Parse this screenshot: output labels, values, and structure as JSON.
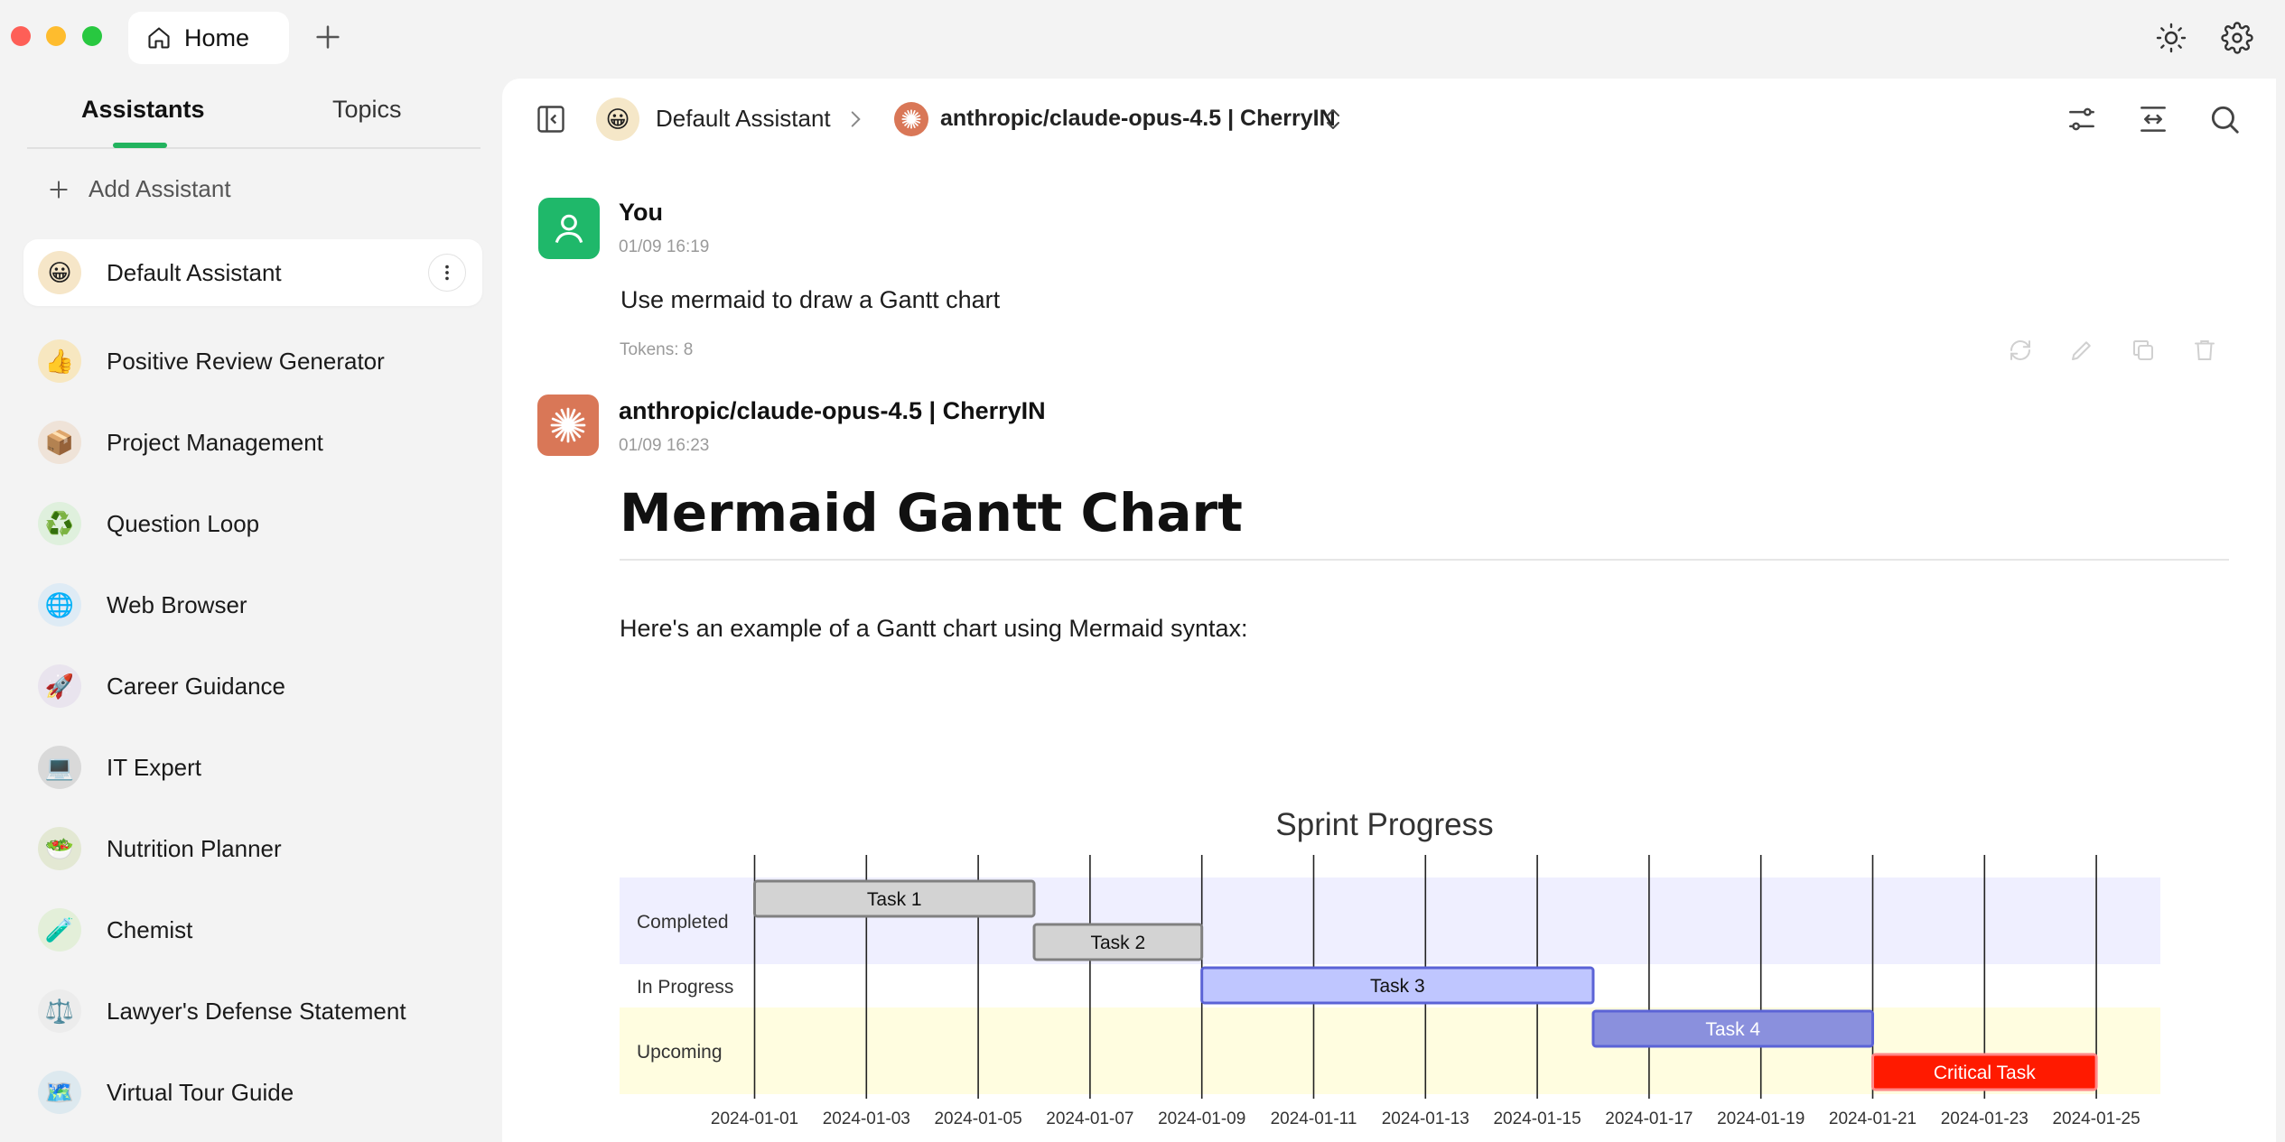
{
  "window": {
    "tab_label": "Home"
  },
  "sidebar": {
    "tabs": [
      "Assistants",
      "Topics"
    ],
    "add_label": "Add Assistant",
    "items": [
      {
        "label": "Default Assistant",
        "emoji": "😀",
        "bg": "#f6e6c8"
      },
      {
        "label": "Positive Review Generator",
        "emoji": "👍",
        "bg": "#f7e7c0"
      },
      {
        "label": "Project Management",
        "emoji": "📦",
        "bg": "#efe3d8"
      },
      {
        "label": "Question Loop",
        "emoji": "♻️",
        "bg": "#dff0dd"
      },
      {
        "label": "Web Browser",
        "emoji": "🌐",
        "bg": "#deebf5"
      },
      {
        "label": "Career Guidance",
        "emoji": "🚀",
        "bg": "#e9e4ee"
      },
      {
        "label": "IT Expert",
        "emoji": "💻",
        "bg": "#d9d9d9"
      },
      {
        "label": "Nutrition Planner",
        "emoji": "🥗",
        "bg": "#e3e8d3"
      },
      {
        "label": "Chemist",
        "emoji": "🧪",
        "bg": "#e3efd9"
      },
      {
        "label": "Lawyer's Defense Statement",
        "emoji": "⚖️",
        "bg": "#ececec"
      },
      {
        "label": "Virtual Tour Guide",
        "emoji": "🗺️",
        "bg": "#dde9ef"
      }
    ]
  },
  "header": {
    "assistant": "Default Assistant",
    "assistant_emoji": "😀",
    "model": "anthropic/claude-opus-4.5 | CherryIN"
  },
  "messages": {
    "user": {
      "name": "You",
      "time": "01/09 16:19",
      "text": "Use mermaid to draw a Gantt chart",
      "tokens": "Tokens: 8"
    },
    "assistant": {
      "name": "anthropic/claude-opus-4.5 | CherryIN",
      "time": "01/09 16:23",
      "heading": "Mermaid Gantt Chart",
      "intro": "Here's an example of a Gantt chart using Mermaid syntax:"
    }
  },
  "colors": {
    "accent": "#22b35e",
    "user_avatar": "#1fb86a",
    "model_avatar": "#d97757"
  },
  "chart_data": {
    "type": "gantt",
    "title": "Sprint Progress",
    "sections": [
      {
        "name": "Completed",
        "color": "#efefff"
      },
      {
        "name": "In Progress",
        "color": "#ffffff"
      },
      {
        "name": "Upcoming",
        "color": "#fffde0"
      }
    ],
    "tasks": [
      {
        "name": "Task 1",
        "section": "Completed",
        "start": "2024-01-01",
        "end": "2024-01-06",
        "status": "done"
      },
      {
        "name": "Task 2",
        "section": "Completed",
        "start": "2024-01-06",
        "end": "2024-01-09",
        "status": "done"
      },
      {
        "name": "Task 3",
        "section": "In Progress",
        "start": "2024-01-09",
        "end": "2024-01-16",
        "status": "active"
      },
      {
        "name": "Task 4",
        "section": "Upcoming",
        "start": "2024-01-16",
        "end": "2024-01-21",
        "status": "future"
      },
      {
        "name": "Critical Task",
        "section": "Upcoming",
        "start": "2024-01-21",
        "end": "2024-01-25",
        "status": "crit"
      }
    ],
    "x_ticks": [
      "2024-01-01",
      "2024-01-03",
      "2024-01-05",
      "2024-01-07",
      "2024-01-09",
      "2024-01-11",
      "2024-01-13",
      "2024-01-15",
      "2024-01-17",
      "2024-01-19",
      "2024-01-21",
      "2024-01-23",
      "2024-01-25"
    ],
    "xlim": [
      "2024-01-01",
      "2024-01-25"
    ],
    "grid": true
  }
}
